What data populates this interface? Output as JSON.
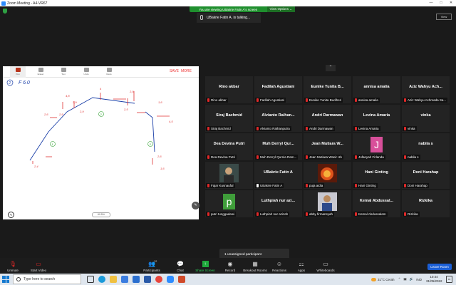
{
  "window": {
    "title": "Zoom Meeting - A4-VR67",
    "controls": [
      "—",
      "□",
      "✕"
    ]
  },
  "banner": {
    "text": "You are viewing UBakrie Fatin A's screen",
    "view_options": "View Options ⌄"
  },
  "talking": {
    "text": "UBakrie Fatin A. is talking..."
  },
  "view_button": "View",
  "whiteboard": {
    "tools": [
      "Pen",
      "Eraser",
      "Text",
      "Undo",
      "Redo"
    ],
    "save": "SAVE",
    "more": "MORE",
    "zoom": "60.5%",
    "question_label": "2",
    "heading": "F 6.0",
    "annotations": [
      "4,8",
      "2,9",
      "4",
      "2,9",
      "2,5",
      "2,5",
      "1,6",
      "4,5",
      "2,6",
      "2,9",
      "2,4",
      "1",
      "2",
      "3",
      "1,6",
      "2,6"
    ]
  },
  "participants": [
    {
      "name": "Rino akbar",
      "label": "Rino akbar"
    },
    {
      "name": "Fadilah Agustiani",
      "label": "Fadilah Agustiani"
    },
    {
      "name": "Eunike Yunita B...",
      "label": "Eunike Yunita Budiheri"
    },
    {
      "name": "annisa amalia",
      "label": "annisa amalia"
    },
    {
      "name": "Aziz Wahyu Ach...",
      "label": "Aziz Wahyu Achmada Sa..."
    },
    {
      "name": "Siraj Bachmid",
      "label": "Siraj Bachmid"
    },
    {
      "name": "Alvianto Raihan...",
      "label": "Alvianto Raihanputra"
    },
    {
      "name": "Andri Darmawan",
      "label": "Andri Darmawan"
    },
    {
      "name": "Levina Amaria",
      "label": "Levina Amaria"
    },
    {
      "name": "vinka",
      "label": "vinka"
    },
    {
      "name": "Dea Devina Putri",
      "label": "Dea Devina Putri"
    },
    {
      "name": "Muh Derryl Qur...",
      "label": "Muh Derryl Qurnia Ram..."
    },
    {
      "name": "Jean Mutiara W...",
      "label": "Jean Mutiara Wanir Hb"
    },
    {
      "name": "",
      "label": "Jofanyah Firlanda",
      "avatar": "J",
      "avatar_color": "#d84f9a"
    },
    {
      "name": "nabila s",
      "label": "nabila s"
    },
    {
      "name": "",
      "label": "Fajar Kusnaufal",
      "photo": "person"
    },
    {
      "name": "UBakrie Fatin A",
      "label": "UBakrie Fatin A",
      "active": true
    },
    {
      "name": "",
      "label": "puja aidia",
      "photo": "fire"
    },
    {
      "name": "Hani Ginting",
      "label": "Hani Ginting"
    },
    {
      "name": "Doni Harahap",
      "label": "Doni Harahap"
    },
    {
      "name": "",
      "label": "putri tunggadewi",
      "avatar": "p",
      "avatar_color": "#3f9d3a"
    },
    {
      "name": "Luthpiah nur azi...",
      "label": "Luthpiah nur azizah"
    },
    {
      "name": "",
      "label": "abby firmansyah",
      "photo": "person2"
    },
    {
      "name": "Kemal Abdussal...",
      "label": "Kemal Abdussalam"
    },
    {
      "name": "Rizkika",
      "label": "Rizkika"
    }
  ],
  "unassigned": "1 unassigned participant",
  "controls": {
    "unmute": "Unmute",
    "start_video": "Start Video",
    "participants": "Participants",
    "participants_count": "32",
    "chat": "Chat",
    "share_screen": "Share Screen",
    "record": "Record",
    "breakout_rooms": "Breakout Rooms",
    "reactions": "Reactions",
    "apps": "Apps",
    "whiteboards": "Whiteboards",
    "leave": "Leave Room"
  },
  "taskbar": {
    "search": "Type here to search",
    "weather": "31°C Cerah",
    "time": "10:44",
    "date": "31/05/2022"
  }
}
